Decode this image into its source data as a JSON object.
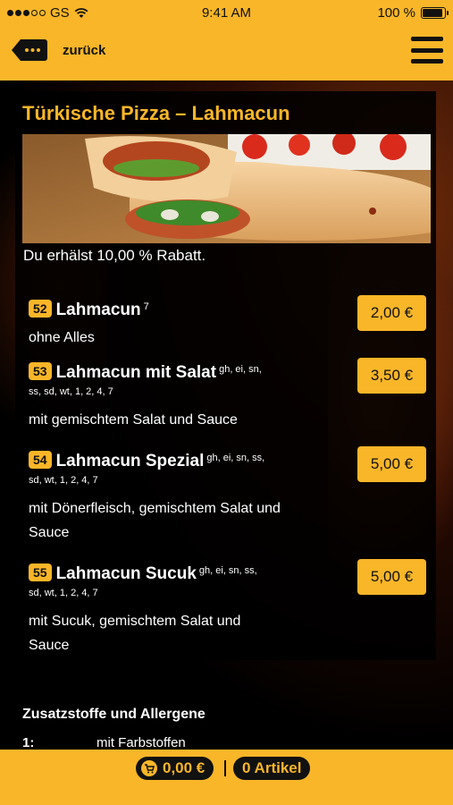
{
  "status": {
    "carrier": "GS",
    "time": "9:41 AM",
    "battery": "100 %"
  },
  "header": {
    "back_label": "zurück"
  },
  "page": {
    "title": "Türkische Pizza – Lahmacun",
    "discount_text": "Du erhälst 10,00 % Rabatt."
  },
  "items": [
    {
      "number": "52",
      "name": "Lahmacun",
      "sup": "7",
      "subline": "",
      "description": "ohne Alles",
      "price": "2,00 €"
    },
    {
      "number": "53",
      "name": "Lahmacun mit Salat",
      "sup": "gh, ei, sn,",
      "subline": "ss, sd, wt, 1, 2, 4, 7",
      "description": "mit gemischtem Salat und Sauce",
      "price": "3,50 €"
    },
    {
      "number": "54",
      "name": "Lahmacun Spezial",
      "sup": "gh, ei, sn, ss,",
      "subline": "sd, wt, 1, 2, 4, 7",
      "description": "mit Dönerfleisch, gemischtem Salat und Sauce",
      "price": "5,00 €"
    },
    {
      "number": "55",
      "name": "Lahmacun Sucuk",
      "sup": "gh, ei, sn, ss,",
      "subline": "sd, wt, 1, 2, 4, 7",
      "description": "mit Sucuk, gemischtem Salat und Sauce",
      "price": "5,00 €"
    }
  ],
  "allergens": {
    "title": "Zusatzstoffe und Allergene",
    "first_key": "1:",
    "first_value": "mit Farbstoffen"
  },
  "cart": {
    "total": "0,00 €",
    "count": "0 Artikel"
  },
  "colors": {
    "accent": "#f9b628",
    "background": "#000000"
  }
}
